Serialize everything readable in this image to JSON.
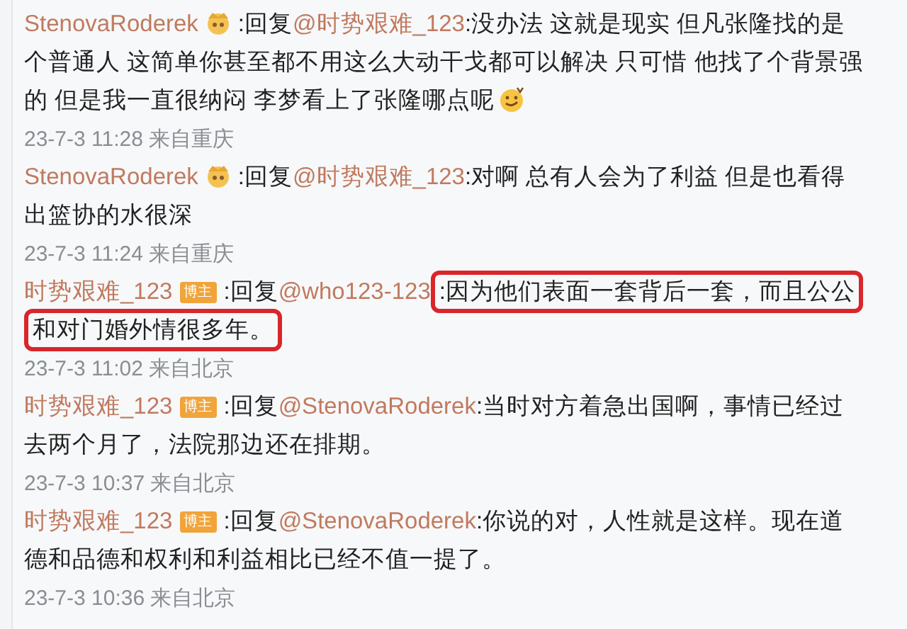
{
  "comments": [
    {
      "author": "StenovaRoderek",
      "kind": "fan",
      "reply_label": ":回复",
      "mention": "@时势艰难_123",
      "content": ":没办法 这就是现实 但凡张隆找的是个普通人 这简单你甚至都不用这么大动干戈都可以解决 只可惜 他找了个背景强的 但是我一直很纳闷 李梦看上了张隆哪点呢",
      "ends_with_emoji": true,
      "highlighted": false,
      "meta": "23-7-3 11:28 来自重庆"
    },
    {
      "author": "StenovaRoderek",
      "kind": "fan",
      "reply_label": ":回复",
      "mention": "@时势艰难_123",
      "content": ":对啊 总有人会为了利益 但是也看得出篮协的水很深",
      "ends_with_emoji": false,
      "highlighted": false,
      "meta": "23-7-3 11:24 来自重庆"
    },
    {
      "author": "时势艰难_123",
      "kind": "blogger",
      "badge": "博主",
      "reply_label": ":回复",
      "mention": "@who123-123",
      "content": ":因为他们表面一套背后一套，而且公公和对门婚外情很多年。",
      "ends_with_emoji": false,
      "highlighted": true,
      "meta": "23-7-3 11:02 来自北京"
    },
    {
      "author": "时势艰难_123",
      "kind": "blogger",
      "badge": "博主",
      "reply_label": ":回复",
      "mention": "@StenovaRoderek",
      "content": ":当时对方着急出国啊，事情已经过去两个月了，法院那边还在排期。",
      "ends_with_emoji": false,
      "highlighted": false,
      "meta": "23-7-3 10:37 来自北京"
    },
    {
      "author": "时势艰难_123",
      "kind": "blogger",
      "badge": "博主",
      "reply_label": ":回复",
      "mention": "@StenovaRoderek",
      "content": ":你说的对，人性就是这样。现在道德和品德和权利和利益相比已经不值一提了。",
      "ends_with_emoji": false,
      "highlighted": false,
      "meta": "23-7-3 10:36 来自北京"
    }
  ]
}
